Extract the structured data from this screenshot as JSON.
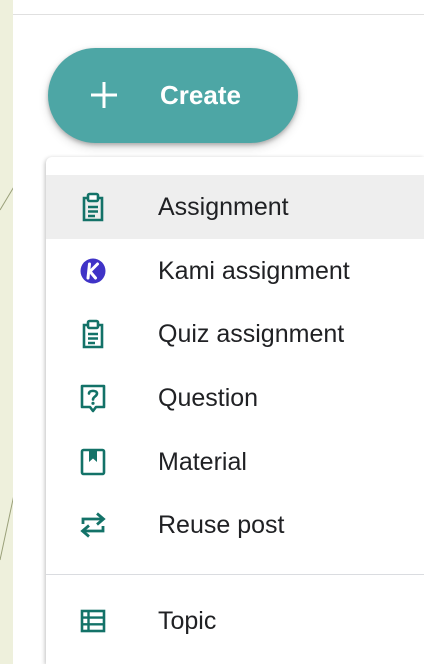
{
  "create": {
    "label": "Create",
    "icon": "plus-icon"
  },
  "menu": {
    "items": [
      {
        "label": "Assignment",
        "icon": "assignment-icon",
        "active": true
      },
      {
        "label": "Kami assignment",
        "icon": "kami-logo-icon"
      },
      {
        "label": "Quiz assignment",
        "icon": "quiz-assignment-icon"
      },
      {
        "label": "Question",
        "icon": "question-icon"
      },
      {
        "label": "Material",
        "icon": "material-icon"
      },
      {
        "label": "Reuse post",
        "icon": "reuse-icon"
      }
    ],
    "footer_items": [
      {
        "label": "Topic",
        "icon": "topic-icon"
      }
    ]
  },
  "colors": {
    "accent": "#4da6a5",
    "icon": "#137268",
    "kami": "#3f33c7",
    "hover": "#eeeeee",
    "text": "#202124",
    "background": "#eef0dc"
  }
}
